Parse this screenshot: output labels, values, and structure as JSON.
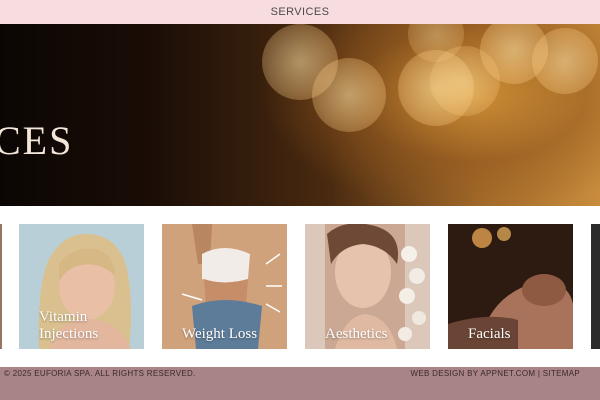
{
  "nav": {
    "active_item": "SERVICES"
  },
  "hero": {
    "title": "CES"
  },
  "services": [
    {
      "label": "Vitamin Injections"
    },
    {
      "label": "Weight Loss"
    },
    {
      "label": "Aesthetics"
    },
    {
      "label": "Facials"
    }
  ],
  "footer": {
    "copyright": "© 2025 EUFORIA SPA. ALL RIGHTS RESERVED.",
    "credit": "WEB DESIGN BY APPNET.COM | SITEMAP"
  },
  "colors": {
    "topbar_bg": "#f8dde0",
    "footer_bg": "#a88486",
    "hero_text": "#f4e6d8"
  }
}
